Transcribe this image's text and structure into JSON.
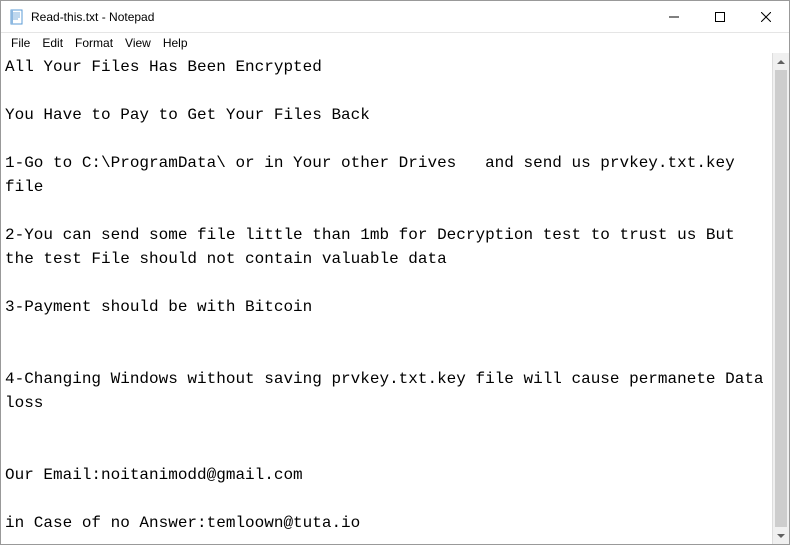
{
  "window": {
    "title": "Read-this.txt - Notepad"
  },
  "menu": {
    "file": "File",
    "edit": "Edit",
    "format": "Format",
    "view": "View",
    "help": "Help"
  },
  "content": {
    "text": "All Your Files Has Been Encrypted\n\nYou Have to Pay to Get Your Files Back\n\n1-Go to C:\\ProgramData\\ or in Your other Drives   and send us prvkey.txt.key  file\n\n2-You can send some file little than 1mb for Decryption test to trust us But the test File should not contain valuable data\n\n3-Payment should be with Bitcoin\n\n\n4-Changing Windows without saving prvkey.txt.key file will cause permanete Data loss\n\n\nOur Email:noitanimodd@gmail.com\n\nin Case of no Answer:temloown@tuta.io"
  }
}
